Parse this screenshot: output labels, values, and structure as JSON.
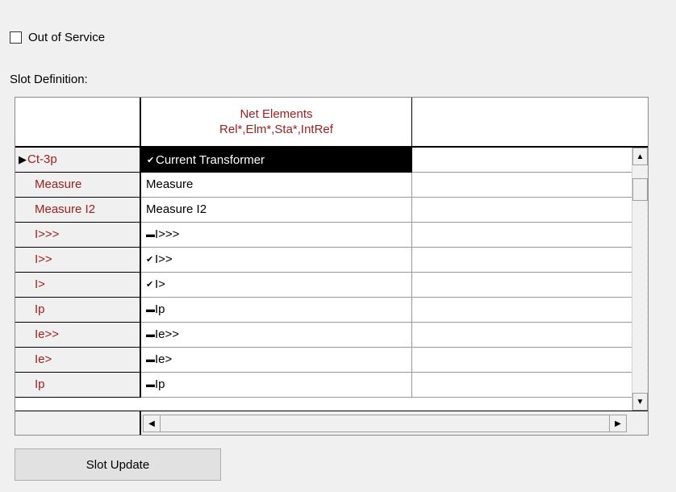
{
  "checkbox": {
    "label": "Out of Service",
    "checked": false
  },
  "slot_definition_label": "Slot Definition:",
  "grid": {
    "column_header": {
      "line1": "Net Elements",
      "line2": "Rel*,Elm*,Sta*,IntRef"
    },
    "rows": [
      {
        "slot": "Ct-3p",
        "value": "Current Transformer",
        "marker": "check",
        "current": true
      },
      {
        "slot": "Measure",
        "value": "Measure",
        "marker": "none",
        "current": false
      },
      {
        "slot": "Measure I2",
        "value": "Measure I2",
        "marker": "none",
        "current": false
      },
      {
        "slot": "I>>>",
        "value": "I>>>",
        "marker": "dash",
        "current": false
      },
      {
        "slot": "I>>",
        "value": "I>>",
        "marker": "check",
        "current": false
      },
      {
        "slot": "I>",
        "value": "I>",
        "marker": "check",
        "current": false
      },
      {
        "slot": "Ip",
        "value": "Ip",
        "marker": "dash",
        "current": false
      },
      {
        "slot": "Ie>>",
        "value": "Ie>>",
        "marker": "dash",
        "current": false
      },
      {
        "slot": "Ie>",
        "value": "Ie>",
        "marker": "dash",
        "current": false
      },
      {
        "slot": "Ip",
        "value": "Ip",
        "marker": "dash",
        "current": false
      }
    ]
  },
  "buttons": {
    "slot_update": "Slot Update"
  },
  "icons": {
    "check": "✔",
    "dash": "▬",
    "row_pointer": "▶",
    "scroll_up": "▲",
    "scroll_down": "▼",
    "scroll_left": "◀",
    "scroll_right": "▶"
  },
  "colors": {
    "header_text": "#a02020",
    "selected_bg": "#000000"
  }
}
